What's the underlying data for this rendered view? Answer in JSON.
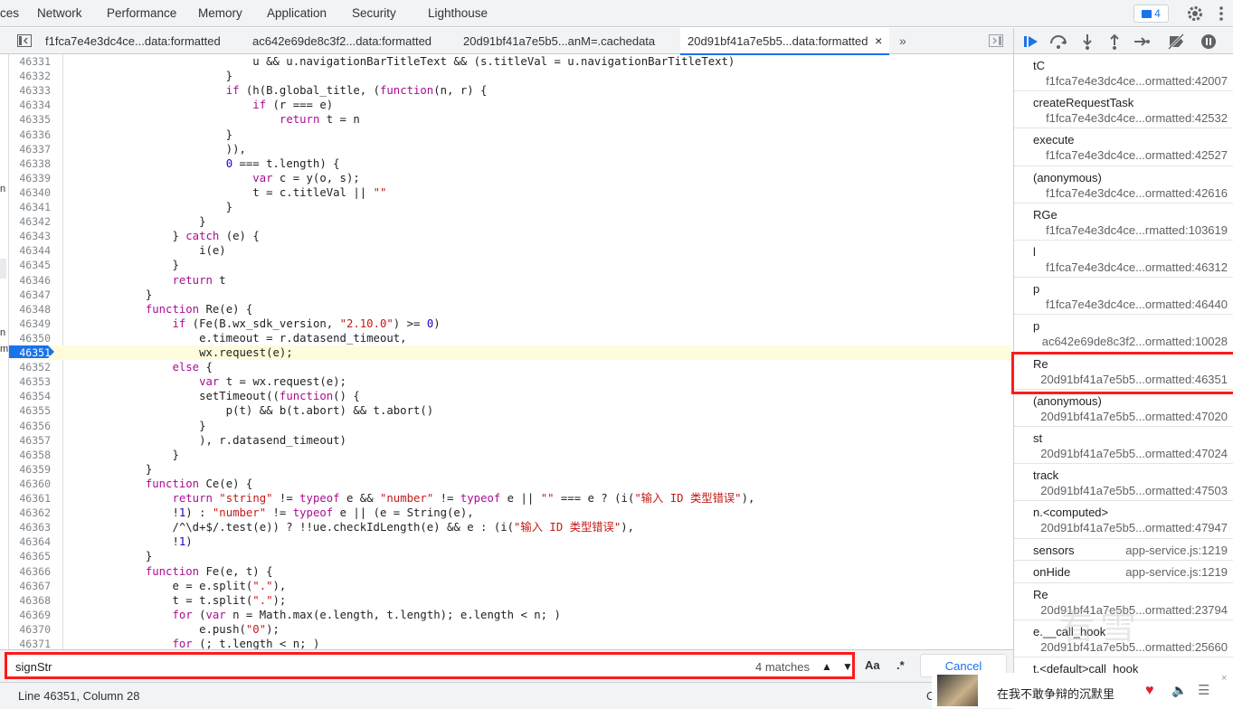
{
  "panel_tabs": [
    "ces",
    "Network",
    "Performance",
    "Memory",
    "Application",
    "Security",
    "Lighthouse"
  ],
  "messages_count": "4",
  "file_tabs": [
    "f1fca7e4e3dc4ce...data:formatted",
    "ac642e69de8c3f2...data:formatted",
    "20d91bf41a7e5b5...anM=.cachedata",
    "20d91bf41a7e5b5...data:formatted"
  ],
  "file_tab_close": "×",
  "more_tabs": "»",
  "left_strip_marks": [
    "n",
    "n",
    "m"
  ],
  "code_lines": [
    {
      "n": "46331",
      "t": "                            u && u.navigationBarTitleText && (s.titleVal = u.navigationBarTitleText)"
    },
    {
      "n": "46332",
      "t": "                        }"
    },
    {
      "n": "46333",
      "t": "                        if (h(B.global_title, (function(n, r) {"
    },
    {
      "n": "46334",
      "t": "                            if (r === e)"
    },
    {
      "n": "46335",
      "t": "                                return t = n"
    },
    {
      "n": "46336",
      "t": "                        }"
    },
    {
      "n": "46337",
      "t": "                        )),"
    },
    {
      "n": "46338",
      "t": "                        0 === t.length) {"
    },
    {
      "n": "46339",
      "t": "                            var c = y(o, s);"
    },
    {
      "n": "46340",
      "t": "                            t = c.titleVal || \"\""
    },
    {
      "n": "46341",
      "t": "                        }"
    },
    {
      "n": "46342",
      "t": "                    }"
    },
    {
      "n": "46343",
      "t": "                } catch (e) {"
    },
    {
      "n": "46344",
      "t": "                    i(e)"
    },
    {
      "n": "46345",
      "t": "                }"
    },
    {
      "n": "46346",
      "t": "                return t"
    },
    {
      "n": "46347",
      "t": "            }"
    },
    {
      "n": "46348",
      "t": "            function Re(e) {"
    },
    {
      "n": "46349",
      "t": "                if (Fe(B.wx_sdk_version, \"2.10.0\") >= 0)"
    },
    {
      "n": "46350",
      "t": "                    e.timeout = r.datasend_timeout,"
    },
    {
      "n": "46351",
      "t": "                    wx.request(e);"
    },
    {
      "n": "46352",
      "t": "                else {"
    },
    {
      "n": "46353",
      "t": "                    var t = wx.request(e);"
    },
    {
      "n": "46354",
      "t": "                    setTimeout((function() {"
    },
    {
      "n": "46355",
      "t": "                        p(t) && b(t.abort) && t.abort()"
    },
    {
      "n": "46356",
      "t": "                    }"
    },
    {
      "n": "46357",
      "t": "                    ), r.datasend_timeout)"
    },
    {
      "n": "46358",
      "t": "                }"
    },
    {
      "n": "46359",
      "t": "            }"
    },
    {
      "n": "46360",
      "t": "            function Ce(e) {"
    },
    {
      "n": "46361",
      "t": "                return \"string\" != typeof e && \"number\" != typeof e || \"\" === e ? (i(\"输入 ID 类型错误\"),"
    },
    {
      "n": "46362",
      "t": "                !1) : \"number\" != typeof e || (e = String(e),"
    },
    {
      "n": "46363",
      "t": "                /^\\d+$/.test(e)) ? !!ue.checkIdLength(e) && e : (i(\"输入 ID 类型错误\"),"
    },
    {
      "n": "46364",
      "t": "                !1)"
    },
    {
      "n": "46365",
      "t": "            }"
    },
    {
      "n": "46366",
      "t": "            function Fe(e, t) {"
    },
    {
      "n": "46367",
      "t": "                e = e.split(\".\"),"
    },
    {
      "n": "46368",
      "t": "                t = t.split(\".\");"
    },
    {
      "n": "46369",
      "t": "                for (var n = Math.max(e.length, t.length); e.length < n; )"
    },
    {
      "n": "46370",
      "t": "                    e.push(\"0\");"
    },
    {
      "n": "46371",
      "t": "                for (; t.length < n; )"
    }
  ],
  "current_line": "46351",
  "call_stack": [
    {
      "name": "tC",
      "loc": "f1fca7e4e3dc4ce...ormatted:42007"
    },
    {
      "name": "createRequestTask",
      "loc": "f1fca7e4e3dc4ce...ormatted:42532"
    },
    {
      "name": "execute",
      "loc": "f1fca7e4e3dc4ce...ormatted:42527"
    },
    {
      "name": "(anonymous)",
      "loc": "f1fca7e4e3dc4ce...ormatted:42616"
    },
    {
      "name": "RGe",
      "loc": "f1fca7e4e3dc4ce...rmatted:103619"
    },
    {
      "name": "l",
      "loc": "f1fca7e4e3dc4ce...ormatted:46312"
    },
    {
      "name": "p",
      "loc": "f1fca7e4e3dc4ce...ormatted:46440"
    },
    {
      "name": "p",
      "loc": "ac642e69de8c3f2...ormatted:10028"
    },
    {
      "name": "Re",
      "loc": "20d91bf41a7e5b5...ormatted:46351"
    },
    {
      "name": "(anonymous)",
      "loc": "20d91bf41a7e5b5...ormatted:47020"
    },
    {
      "name": "st",
      "loc": "20d91bf41a7e5b5...ormatted:47024"
    },
    {
      "name": "track",
      "loc": "20d91bf41a7e5b5...ormatted:47503"
    },
    {
      "name": "n.<computed>",
      "loc": "20d91bf41a7e5b5...ormatted:47947"
    },
    {
      "name": "sensors",
      "loc": "app-service.js:1219",
      "inline": true
    },
    {
      "name": "onHide",
      "loc": "app-service.js:1219",
      "inline": true
    },
    {
      "name": "Re",
      "loc": "20d91bf41a7e5b5...ormatted:23794"
    },
    {
      "name": "e.__call_hook",
      "loc": "20d91bf41a7e5b5...ormatted:25660"
    },
    {
      "name": "t.<default>call_hook",
      "loc": ""
    }
  ],
  "search": {
    "value": "signStr",
    "matches": "4 matches",
    "prev": "▲",
    "next": "▼",
    "case_label": "Aa",
    "regex_label": ".*",
    "cancel": "Cancel"
  },
  "status": {
    "position": "Line 46351, Column 28",
    "right_partial": "C"
  },
  "music": {
    "title": "在我不敢争辩的沉默里",
    "close": "×"
  },
  "watermark": "看雪",
  "colors": {
    "accent": "#1a73e8",
    "highlight_box": "#ff1a1a",
    "current_line_bg": "#fffbdd"
  }
}
